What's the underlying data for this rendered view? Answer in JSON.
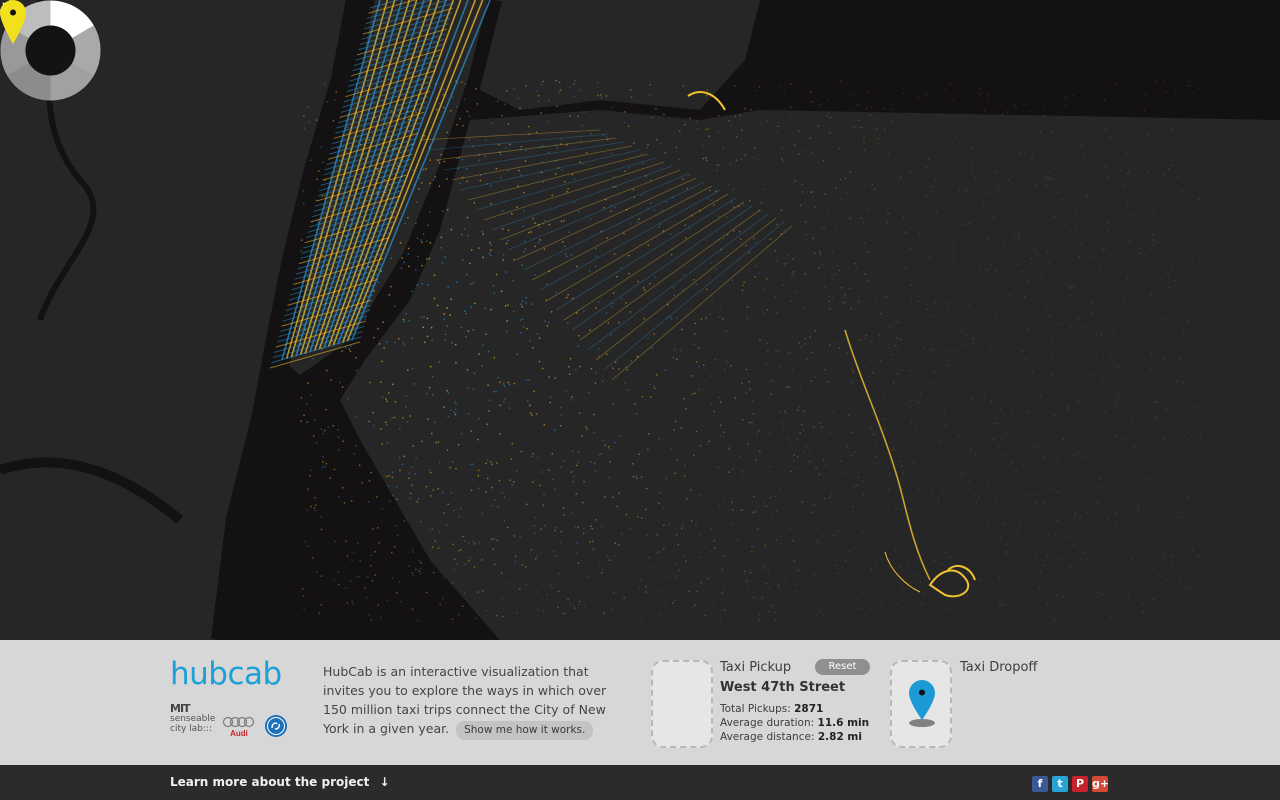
{
  "map": {
    "zoom_out_label": "−",
    "zoom_in_label": "+"
  },
  "colors": {
    "accent": "#1ba0d8",
    "trip_yellow": "#f2c230",
    "trip_blue": "#2a8fc9",
    "map_background": "#131111",
    "land": "#2a2929",
    "panel": "#d7d7d7",
    "footer": "#2b2b2b"
  },
  "icons": {
    "sun": "sun-icon",
    "moon": "moon-icon",
    "pickup_marker": "map-pin-icon",
    "dropoff_marker": "map-pin-icon"
  },
  "panel": {
    "logo": "hubcab",
    "sponsor_mit_line1": "MIT",
    "sponsor_mit_line2": "senseable",
    "sponsor_mit_line3": "city lab:::",
    "sponsor_audi": "Audi",
    "description": "HubCab is an interactive visualization that invites you to explore the ways in which over 150 million taxi trips connect the City of New York in a given year.",
    "how_button": "Show me how it works.",
    "pickup": {
      "title": "Taxi Pickup",
      "street": "West 47th Street",
      "total_label": "Total Pickups:",
      "total_value": "2871",
      "duration_label": "Average duration:",
      "duration_value": "11.6 min",
      "distance_label": "Average distance:",
      "distance_value": "2.82 mi",
      "reset_label": "Reset"
    },
    "dropoff": {
      "title": "Taxi Dropoff"
    }
  },
  "footer": {
    "learn_more": "Learn more about the project",
    "learn_more_arrow": "↓",
    "social": [
      "f",
      "t",
      "P",
      "g+"
    ]
  }
}
